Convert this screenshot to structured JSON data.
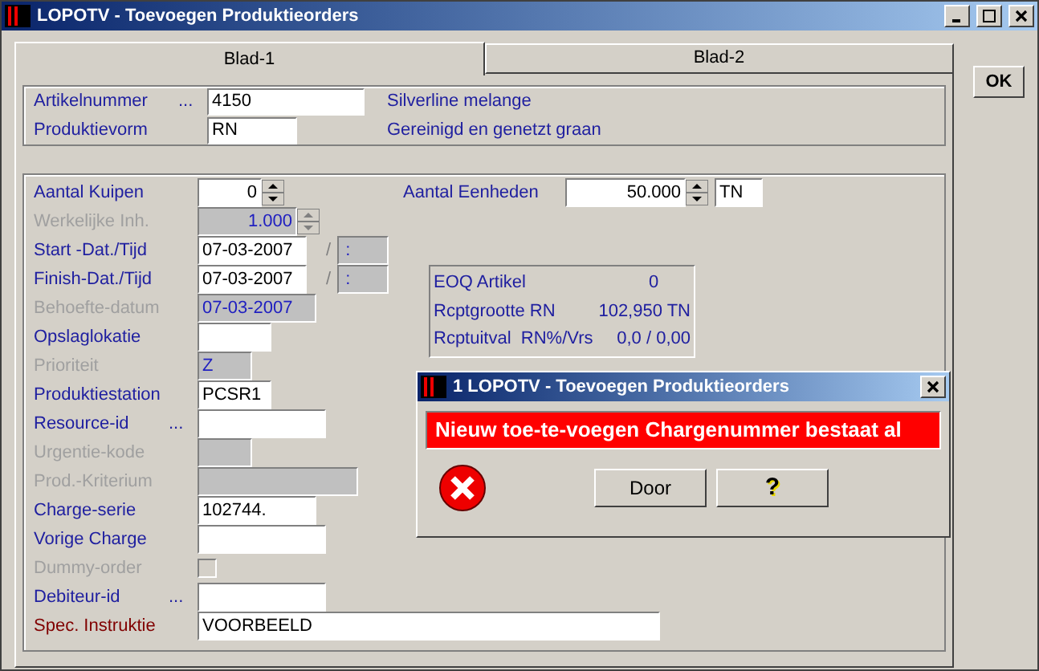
{
  "window": {
    "title": "LOPOTV - Toevoegen Produktieorders"
  },
  "ok_button": {
    "label": "OK"
  },
  "tabs": [
    {
      "label": "Blad-1",
      "selected": true
    },
    {
      "label": "Blad-2",
      "selected": false
    }
  ],
  "article": [
    {
      "label": "Artikelnummer",
      "lookup": "...",
      "value": "4150",
      "description": "Silverline melange"
    },
    {
      "label": "Produktievorm",
      "value": "RN",
      "description": "Gereinigd en genetzt graan"
    }
  ],
  "fields": [
    {
      "label": "Aantal Kuipen",
      "kind": "spin",
      "value": "0",
      "disabled": false,
      "highlight": false
    },
    {
      "label": "Werkelijke Inh.",
      "kind": "spin",
      "value": "1.000",
      "disabled": true,
      "highlight": false
    },
    {
      "label": "Start -Dat./Tijd",
      "kind": "date",
      "value": "07-03-2007",
      "disabled": false,
      "highlight": false,
      "separator": "/",
      "time": ":"
    },
    {
      "label": "Finish-Dat./Tijd",
      "kind": "date",
      "value": "07-03-2007",
      "disabled": false,
      "highlight": false,
      "separator": "/",
      "time": ":"
    },
    {
      "label": "Behoefte-datum",
      "kind": "text",
      "value": "07-03-2007",
      "disabled": true,
      "highlight": false
    },
    {
      "label": "Opslaglokatie",
      "kind": "text",
      "disabled": false,
      "highlight": false
    },
    {
      "label": "Prioriteit",
      "kind": "text",
      "value": "Z",
      "disabled": true,
      "highlight": false
    },
    {
      "label": "Produktiestation",
      "kind": "text",
      "value": "PCSR1",
      "disabled": false,
      "highlight": false
    },
    {
      "label": "Resource-id",
      "lookup": "...",
      "kind": "text",
      "disabled": false,
      "highlight": false
    },
    {
      "label": "Urgentie-kode",
      "kind": "text",
      "disabled": true,
      "highlight": false
    },
    {
      "label": "Prod.-Kriterium",
      "kind": "text",
      "disabled": true,
      "highlight": false
    },
    {
      "label": "Charge-serie",
      "kind": "text",
      "value": "102744.",
      "disabled": false,
      "highlight": false
    },
    {
      "label": "Vorige Charge",
      "kind": "text",
      "disabled": false,
      "highlight": false
    },
    {
      "label": "Dummy-order",
      "kind": "checkbox",
      "checked": false,
      "disabled": true,
      "highlight": false
    },
    {
      "label": "Debiteur-id",
      "lookup": "...",
      "kind": "text",
      "disabled": false,
      "highlight": false
    },
    {
      "label": "Spec. Instruktie",
      "kind": "text",
      "value": "VOORBEELD",
      "disabled": false,
      "highlight": true
    }
  ],
  "units": {
    "label": "Aantal Eenheden",
    "value": "50.000",
    "unit": "TN"
  },
  "eoq": [
    {
      "label": "EOQ Artikel",
      "value": "0"
    },
    {
      "label": "Rcptgrootte RN",
      "value": "102,950 TN"
    },
    {
      "label": "Rcptuitval  RN",
      "extra": "%/Vrs",
      "value": "0,0 / 0,00"
    }
  ],
  "dialog": {
    "title": "1 LOPOTV - Toevoegen Produktieorders",
    "message": "Nieuw toe-te-voegen Chargenummer bestaat al",
    "buttons": [
      {
        "kind": "text",
        "label": "Door"
      },
      {
        "kind": "help",
        "label": "?"
      }
    ]
  }
}
